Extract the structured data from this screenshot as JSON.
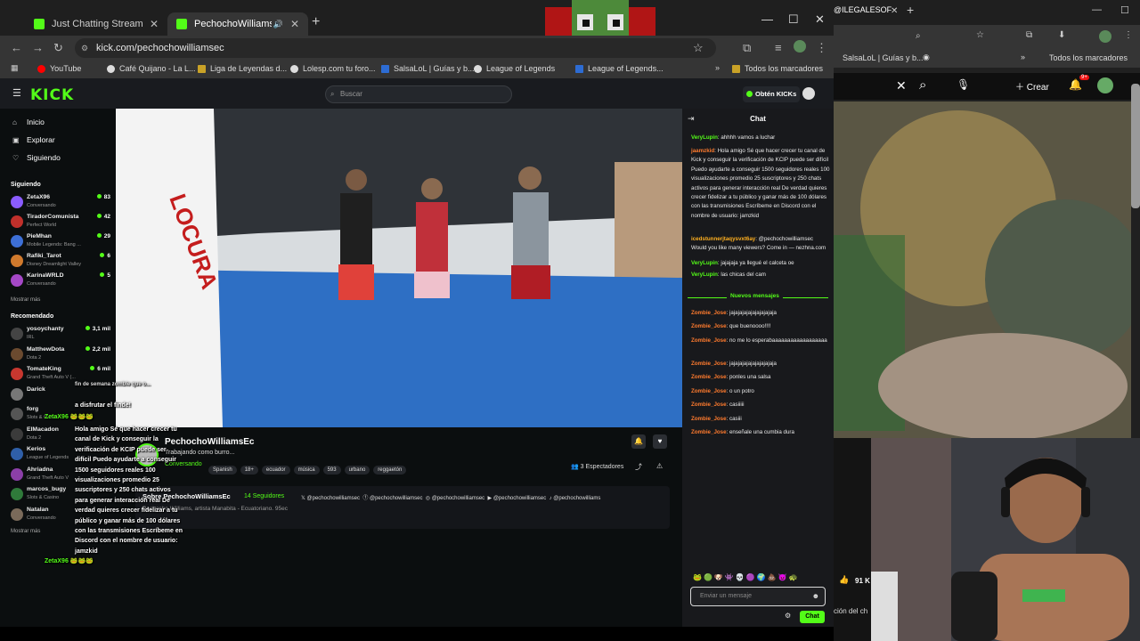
{
  "browser": {
    "tabs": [
      {
        "title": "Just Chatting Streaming - Live S"
      },
      {
        "title": "PechochoWilliamsEc Stream"
      }
    ],
    "address": "kick.com/pechochowilliamsec",
    "bookmarks": [
      "YouTube",
      "Café Quijano - La L...",
      "Liga de Leyendas d...",
      "Lolesp.com tu foro...",
      "SalsaLoL | Guías y b...",
      "League of Legends",
      "League of Legends..."
    ],
    "all_bookmarks": "Todos los marcadores"
  },
  "right_browser": {
    "tab_title": "@ILEGALESOF",
    "bookmark1": "SalsaLoL | Guías y b...",
    "all_bookmarks": "Todos los marcadores",
    "create": "Crear",
    "notif_badge": "9+",
    "likes": "91 K",
    "chat_fragment": "ción del ch"
  },
  "kick": {
    "search_placeholder": "Buscar",
    "get_kicks": "Obtén KICKs",
    "nav": {
      "home": "Inicio",
      "explore": "Explorar",
      "following": "Siguiendo"
    },
    "following_header": "Siguiendo",
    "following": [
      {
        "name": "ZetaX96",
        "game": "Conversando",
        "viewers": "83",
        "color": "#8a5cff"
      },
      {
        "name": "TiradorComunista",
        "game": "Perfect World",
        "viewers": "42",
        "color": "#c0302b"
      },
      {
        "name": "PieMhan",
        "game": "Mobile Legends: Bang ...",
        "viewers": "29",
        "color": "#3d6fd6"
      },
      {
        "name": "Rafiki_Tarot",
        "game": "Disney Dreamlight Valley",
        "viewers": "6",
        "color": "#d07a2d"
      },
      {
        "name": "KarinaWRLD",
        "game": "Conversando",
        "viewers": "5",
        "color": "#a548c7"
      }
    ],
    "show_more": "Mostrar más",
    "recommended_header": "Recomendado",
    "recommended": [
      {
        "name": "yosoychanty",
        "game": "IRL",
        "viewers": "3,1 mil",
        "color": "#444"
      },
      {
        "name": "MatthewDota",
        "game": "Dota 2",
        "viewers": "2,2 mil",
        "color": "#6b4a2f"
      },
      {
        "name": "TomateKing",
        "game": "Grand Theft Auto V (...",
        "viewers": "6 mil",
        "color": "#c7372f"
      },
      {
        "name": "Darick",
        "game": "",
        "viewers": "",
        "color": "#777"
      },
      {
        "name": "forg",
        "game": "Slots & Casino",
        "viewers": "",
        "color": "#555"
      },
      {
        "name": "ElMacadon",
        "game": "Dota 2",
        "viewers": "",
        "color": "#3b3b3b"
      },
      {
        "name": "Kerios",
        "game": "League of Legends",
        "viewers": "",
        "color": "#2f5fa8"
      },
      {
        "name": "Ahriadna",
        "game": "Grand Theft Auto V",
        "viewers": "",
        "color": "#8b3fa8"
      },
      {
        "name": "marcos_bugy",
        "game": "Slots & Casino",
        "viewers": "",
        "color": "#2f7a3a"
      },
      {
        "name": "Natalan",
        "game": "Conversando",
        "viewers": "",
        "color": "#7a6a5a"
      }
    ],
    "show_more2": "Mostrar más",
    "streamer": {
      "name": "PechochoWilliamsEc",
      "title": "Trabajando como burro...",
      "category": "Conversando",
      "tags": [
        "Spanish",
        "18+",
        "ecuador",
        "música",
        "593",
        "urbano",
        "reggaetón"
      ],
      "viewers": "3 Espectadores",
      "about_label": "Sobre PechochoWilliamsEc",
      "followers": "14 Seguidores",
      "bio": "Pechocho Williams, artista Manabita - Ecuatoriano. 95ec",
      "socials": [
        "@pechochowilliamsec",
        "@pechochowilliamsec",
        "@pechochowilliamsec",
        "@pechochowilliamsec",
        "@pechochowilliams"
      ]
    },
    "chat": {
      "title": "Chat",
      "new_messages": "Nuevos mensajes",
      "messages": [
        {
          "user": "VeryLupin",
          "text": ": ahhhh vamos a luchar",
          "color": "#53fc18"
        },
        {
          "user": "jaamzkid",
          "text": ": Hola amigo Sé que hacer crecer tu canal de Kick y conseguir la verificación de KCIP puede ser difícil Puedo ayudarte a conseguir 1500 seguidores reales 100 visualizaciones promedio 25 suscriptores y 250 chats activos para generar interacción real De verdad quieres crecer fidelizar a tu público y ganar más de 100 dólares con las transmisiones Escríbeme en Discord con el nombre de usuario: jamzkid",
          "color": "#ff7b2e"
        },
        {
          "user": "icedstunnerjtaqysvxt6ay",
          "text": ": @pechochowilliamsec Would you like many viewers? Come in — nezhna.com",
          "color": "#ffb020"
        },
        {
          "user": "VeryLupin",
          "text": ": jajajaja ya llegué el calceta oe",
          "color": "#53fc18"
        },
        {
          "user": "VeryLupin",
          "text": ": las chicas del cam",
          "color": "#53fc18"
        }
      ],
      "new_list": [
        {
          "user": "Zombie_Jose",
          "text": ": jajajajajajajajajajaja"
        },
        {
          "user": "Zombie_Jose",
          "text": ": que buenoooo!!!!"
        },
        {
          "user": "Zombie_Jose",
          "text": ": no me lo esperabaaaaaaaaaaaaaaaaaa"
        },
        {
          "user": "Zombie_Jose",
          "text": ": jajajajajajajajajajaja"
        },
        {
          "user": "Zombie_Jose",
          "text": ": ponles una salsa"
        },
        {
          "user": "Zombie_Jose",
          "text": ": o un potro"
        },
        {
          "user": "Zombie_Jose",
          "text": ": casiiiii"
        },
        {
          "user": "Zombie_Jose",
          "text": ": casiii"
        },
        {
          "user": "Zombie_Jose",
          "text": ": enseñale una cumbia dura"
        }
      ],
      "user_color": "#ff7b2e",
      "input_placeholder": "Enviar un mensaje",
      "send": "Chat"
    }
  },
  "overlay": {
    "line1": "a disfrutar el finde!",
    "user1": "ZetaX96",
    "spam": "Hola amigo Sé que hacer crecer tu canal de Kick y conseguir la verificación de KCIP puede ser difícil Puedo ayudarte a conseguir 1500 seguidores reales 100 visualizaciones promedio 25 suscriptores y 250 chats activos para generar interacción real De verdad quieres crecer fidelizar a tu público y ganar más de 100 dólares con las transmisiones Escríbeme en Discord con el nombre de usuario: jamzkid",
    "user2": "ZetaX96",
    "top_fragment": "fin de semana zombie que o..."
  },
  "colors": {
    "kick_green": "#53fc18",
    "bg": "#0b0e0f"
  }
}
